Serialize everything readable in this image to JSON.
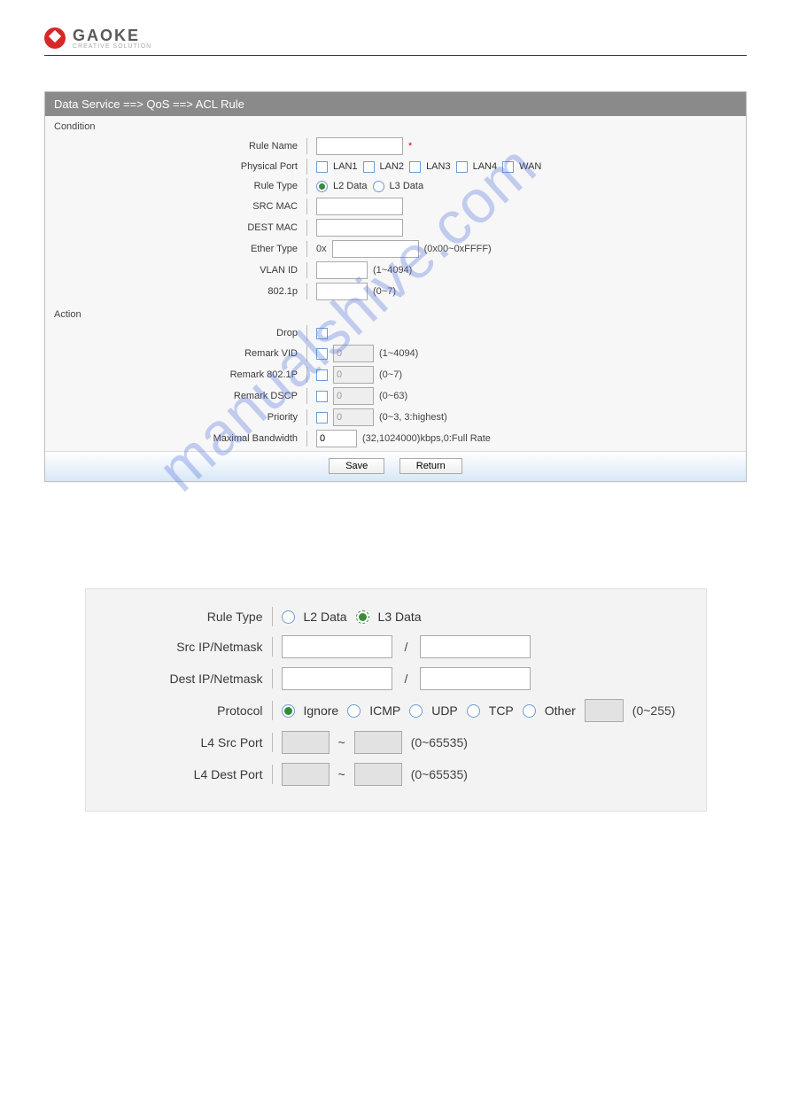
{
  "header": {
    "brand": "GAOKE",
    "tagline": "CREATIVE SOLUTION"
  },
  "watermark": "manualshive.com",
  "panel1": {
    "title": "Data Service ==> QoS ==> ACL Rule",
    "condition_section": "Condition",
    "action_section": "Action",
    "labels": {
      "rule_name": "Rule Name",
      "physical_port": "Physical Port",
      "rule_type": "Rule Type",
      "src_mac": "SRC MAC",
      "dest_mac": "DEST MAC",
      "ether_type": "Ether Type",
      "vlan_id": "VLAN ID",
      "p8021": "802.1p",
      "drop": "Drop",
      "remark_vid": "Remark VID",
      "remark_8021p": "Remark 802.1P",
      "remark_dscp": "Remark DSCP",
      "priority": "Priority",
      "max_bw": "Maximal Bandwidth"
    },
    "required_mark": "*",
    "ports": [
      "LAN1",
      "LAN2",
      "LAN3",
      "LAN4",
      "WAN"
    ],
    "rule_types": {
      "l2": "L2 Data",
      "l3": "L3 Data"
    },
    "ether_prefix": "0x",
    "hints": {
      "ether": "(0x00~0xFFFF)",
      "vlan": "(1~4094)",
      "p8021": "(0~7)",
      "remark_vid": "(1~4094)",
      "remark_8021p": "(0~7)",
      "remark_dscp": "(0~63)",
      "priority": "(0~3, 3:highest)",
      "max_bw": "(32,1024000)kbps,0:Full Rate"
    },
    "values": {
      "remark_vid": "0",
      "remark_8021p": "0",
      "remark_dscp": "0",
      "priority": "0",
      "max_bw": "0"
    },
    "buttons": {
      "save": "Save",
      "return": "Return"
    }
  },
  "panel2": {
    "labels": {
      "rule_type": "Rule Type",
      "src_ip": "Src IP/Netmask",
      "dest_ip": "Dest IP/Netmask",
      "protocol": "Protocol",
      "l4_src": "L4 Src Port",
      "l4_dest": "L4 Dest Port"
    },
    "rule_types": {
      "l2": "L2 Data",
      "l3": "L3 Data"
    },
    "slash": "/",
    "tilde": "~",
    "protocols": {
      "ignore": "Ignore",
      "icmp": "ICMP",
      "udp": "UDP",
      "tcp": "TCP",
      "other": "Other"
    },
    "hints": {
      "other": "(0~255)",
      "l4": "(0~65535)"
    }
  }
}
